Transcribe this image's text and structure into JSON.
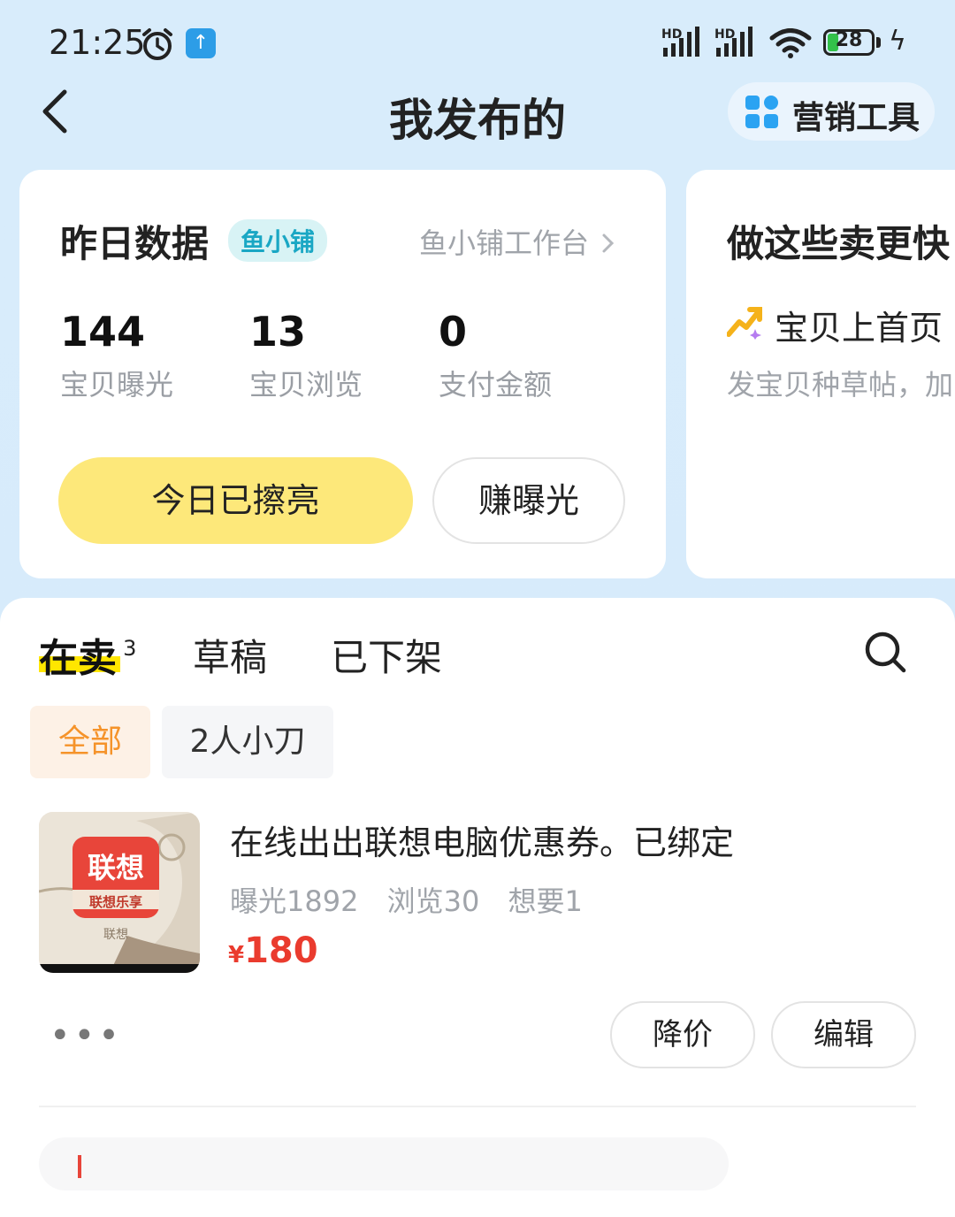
{
  "status_bar": {
    "time": "21:25",
    "battery": "28",
    "net1": "HD",
    "net2": "HD"
  },
  "nav": {
    "title": "我发布的",
    "marketing_label": "营销工具"
  },
  "data_card": {
    "title": "昨日数据",
    "badge": "鱼小铺",
    "workbench_link": "鱼小铺工作台",
    "stats": [
      {
        "value": "144",
        "label": "宝贝曝光"
      },
      {
        "value": "13",
        "label": "宝贝浏览"
      },
      {
        "value": "0",
        "label": "支付金额"
      }
    ],
    "polish_button": "今日已擦亮",
    "exposure_button": "赚曝光"
  },
  "tips_card": {
    "title": "做这些卖更快",
    "item_label": "宝贝上首页",
    "item_desc": "发宝贝种草帖，加"
  },
  "tabs": [
    {
      "label": "在卖",
      "count": "3"
    },
    {
      "label": "草稿"
    },
    {
      "label": "已下架"
    }
  ],
  "filters": [
    "全部",
    "2人小刀"
  ],
  "product": {
    "title": "在线出出联想电脑优惠券。已绑定",
    "views": "曝光1892",
    "browse": "浏览30",
    "wants": "想要1",
    "currency": "¥",
    "price": "180",
    "thumb_brand": "联想",
    "thumb_sub": "联想乐享",
    "thumb_foot": "联想"
  },
  "actions": {
    "more": "•••",
    "reduce_price": "降价",
    "edit": "编辑"
  },
  "colors": {
    "accent_yellow": "#fde87a",
    "price_red": "#ea3b2e",
    "chip_orange": "#f5932a",
    "badge_teal": "#1aa7c4"
  }
}
